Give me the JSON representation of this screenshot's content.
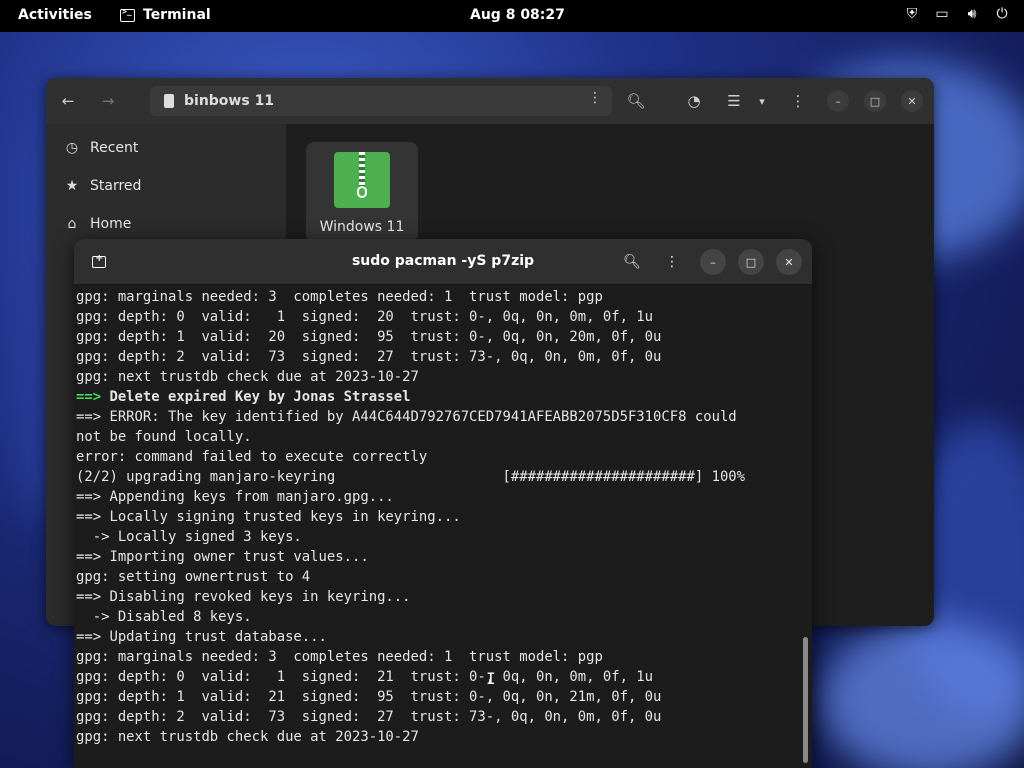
{
  "topbar": {
    "activities": "Activities",
    "app_name": "Terminal",
    "clock": "Aug 8  08:27",
    "tray_icons": [
      "shield-icon",
      "network-icon",
      "volume-icon",
      "power-icon"
    ]
  },
  "files": {
    "path": "binbows 11",
    "sidebar": [
      {
        "label": "Recent",
        "icon": "clock-icon"
      },
      {
        "label": "Starred",
        "icon": "star-icon"
      },
      {
        "label": "Home",
        "icon": "home-icon"
      }
    ],
    "item": {
      "name": "Windows 11",
      "icon": "archive-icon"
    }
  },
  "terminal": {
    "title": "sudo pacman -yS p7zip",
    "lines": [
      {
        "text": "gpg: marginals needed: 3  completes needed: 1  trust model: pgp",
        "style": ""
      },
      {
        "text": "gpg: depth: 0  valid:   1  signed:  20  trust: 0-, 0q, 0n, 0m, 0f, 1u",
        "style": ""
      },
      {
        "text": "gpg: depth: 1  valid:  20  signed:  95  trust: 0-, 0q, 0n, 20m, 0f, 0u",
        "style": ""
      },
      {
        "text": "gpg: depth: 2  valid:  73  signed:  27  trust: 73-, 0q, 0n, 0m, 0f, 0u",
        "style": ""
      },
      {
        "text": "gpg: next trustdb check due at 2023-10-27",
        "style": ""
      },
      {
        "prefix": "==> ",
        "text": "Delete expired Key by Jonas Strassel",
        "style": "bold"
      },
      {
        "text": "==> ERROR: The key identified by A44C644D792767CED7941AFEABB2075D5F310CF8 could",
        "style": ""
      },
      {
        "text": "not be found locally.",
        "style": ""
      },
      {
        "text": "error: command failed to execute correctly",
        "style": ""
      },
      {
        "text": "(2/2) upgrading manjaro-keyring                    [######################] 100%",
        "style": ""
      },
      {
        "text": "==> Appending keys from manjaro.gpg...",
        "style": ""
      },
      {
        "text": "==> Locally signing trusted keys in keyring...",
        "style": ""
      },
      {
        "text": "  -> Locally signed 3 keys.",
        "style": ""
      },
      {
        "text": "==> Importing owner trust values...",
        "style": ""
      },
      {
        "text": "gpg: setting ownertrust to 4",
        "style": ""
      },
      {
        "text": "==> Disabling revoked keys in keyring...",
        "style": ""
      },
      {
        "text": "  -> Disabled 8 keys.",
        "style": ""
      },
      {
        "text": "==> Updating trust database...",
        "style": ""
      },
      {
        "text": "gpg: marginals needed: 3  completes needed: 1  trust model: pgp",
        "style": ""
      },
      {
        "text": "gpg: depth: 0  valid:   1  signed:  21  trust: 0-, 0q, 0n, 0m, 0f, 1u",
        "style": ""
      },
      {
        "text": "gpg: depth: 1  valid:  21  signed:  95  trust: 0-, 0q, 0n, 21m, 0f, 0u",
        "style": ""
      },
      {
        "text": "gpg: depth: 2  valid:  73  signed:  27  trust: 73-, 0q, 0n, 0m, 0f, 0u",
        "style": ""
      },
      {
        "text": "gpg: next trustdb check due at 2023-10-27",
        "style": ""
      }
    ]
  },
  "colors": {
    "accent_green": "#4bd65b",
    "archive_green": "#4caf50"
  }
}
